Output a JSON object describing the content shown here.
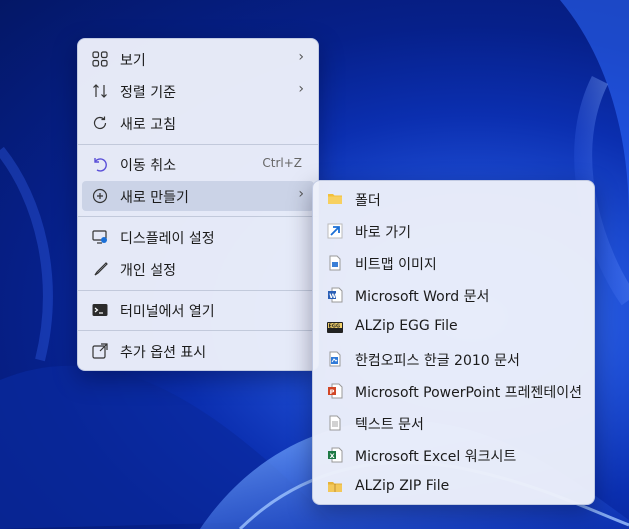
{
  "main_menu": {
    "items": [
      {
        "label": "보기",
        "icon": "grid-icon"
      },
      {
        "label": "정렬 기준",
        "icon": "sort-icon"
      },
      {
        "label": "새로 고침",
        "icon": "refresh-icon"
      },
      {
        "label": "이동 취소",
        "icon": "undo-icon",
        "shortcut": "Ctrl+Z"
      },
      {
        "label": "새로 만들기",
        "icon": "new-icon"
      },
      {
        "label": "디스플레이 설정",
        "icon": "display-icon"
      },
      {
        "label": "개인 설정",
        "icon": "brush-icon"
      },
      {
        "label": "터미널에서 열기",
        "icon": "terminal-icon"
      },
      {
        "label": "추가 옵션 표시",
        "icon": "more-options-icon"
      }
    ],
    "arrow": "›"
  },
  "sub_menu": {
    "items": [
      {
        "label": "폴더",
        "icon": "folder-icon"
      },
      {
        "label": "바로 가기",
        "icon": "shortcut-icon"
      },
      {
        "label": "비트맵 이미지",
        "icon": "bitmap-icon"
      },
      {
        "label": "Microsoft Word 문서",
        "icon": "word-icon"
      },
      {
        "label": "ALZip EGG File",
        "icon": "egg-icon"
      },
      {
        "label": "한컴오피스 한글 2010 문서",
        "icon": "hwp-icon"
      },
      {
        "label": "Microsoft PowerPoint 프레젠테이션",
        "icon": "powerpoint-icon"
      },
      {
        "label": "텍스트 문서",
        "icon": "text-doc-icon"
      },
      {
        "label": "Microsoft Excel 워크시트",
        "icon": "excel-icon"
      },
      {
        "label": "ALZip ZIP File",
        "icon": "zip-icon"
      }
    ],
    "egg_badge": "EGG"
  },
  "colors": {
    "menu_bg": "#eef1fa",
    "highlight": "#c8d0e4",
    "folder": "#f3c03a",
    "word": "#2b5fb6",
    "powerpoint": "#d24726",
    "excel": "#1f7a45",
    "accent_blue": "#1a6fd6"
  }
}
